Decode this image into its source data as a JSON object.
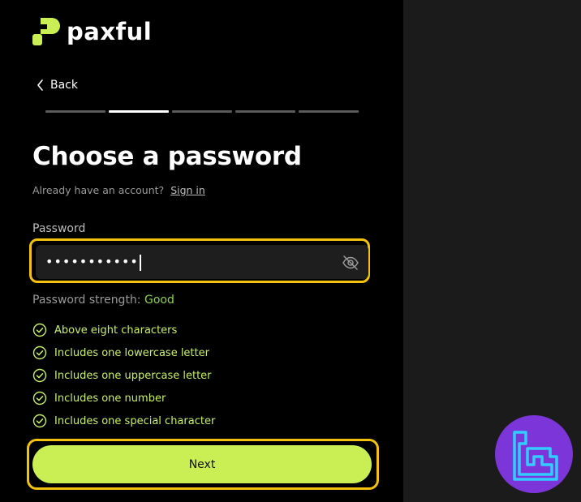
{
  "brand": {
    "name": "paxful",
    "accent": "#c9ef55"
  },
  "nav": {
    "back_label": "Back",
    "steps_total": 5,
    "current_step": 2
  },
  "heading": {
    "title": "Choose a password"
  },
  "account": {
    "prompt": "Already have an account?",
    "signin_label": "Sign in"
  },
  "password": {
    "label": "Password",
    "masked_value": "•••••••••••",
    "visibility_icon": "eye-off-icon"
  },
  "strength": {
    "label": "Password strength:",
    "value": "Good",
    "color": "#8fd14f"
  },
  "requirements": [
    {
      "label": "Above eight characters",
      "met": true
    },
    {
      "label": "Includes one lowercase letter",
      "met": true
    },
    {
      "label": "Includes one uppercase letter",
      "met": true
    },
    {
      "label": "Includes one number",
      "met": true
    },
    {
      "label": "Includes one special character",
      "met": true
    }
  ],
  "actions": {
    "next_label": "Next"
  },
  "highlight_color": "#f4c20d",
  "watermark": {
    "icon": "tc-logo-icon",
    "color": "#7b35d8"
  }
}
